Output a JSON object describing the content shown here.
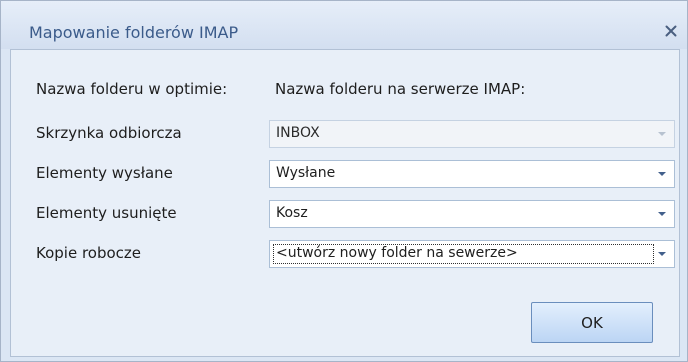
{
  "window": {
    "title": "Mapowanie folderów IMAP",
    "close_glyph": "x"
  },
  "headers": {
    "local": "Nazwa folderu w optimie:",
    "server": "Nazwa folderu na serwerze IMAP:"
  },
  "rows": [
    {
      "label": "Skrzynka odbiorcza",
      "value": "INBOX",
      "enabled": false
    },
    {
      "label": "Elementy wysłane",
      "value": "Wysłane",
      "enabled": true
    },
    {
      "label": "Elementy usunięte",
      "value": "Kosz",
      "enabled": true
    },
    {
      "label": "Kopie robocze",
      "value": "<utwórz nowy folder na sewerze>",
      "enabled": true,
      "focused": true
    }
  ],
  "buttons": {
    "ok": "OK"
  },
  "icons": {
    "close": "close-icon",
    "dropdown": "chevron-down-icon"
  }
}
